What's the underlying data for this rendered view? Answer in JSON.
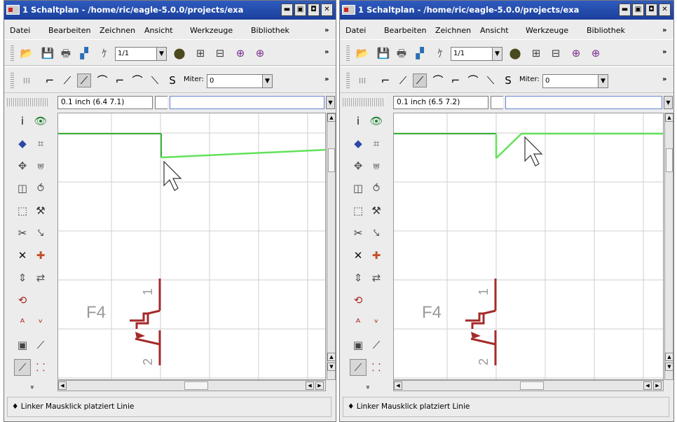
{
  "windows": [
    {
      "title": "1 Schaltplan - /home/ric/eagle-5.0.0/projects/exa",
      "menu": [
        "Datei",
        "Bearbeiten",
        "Zeichnen",
        "Ansicht",
        "Werkzeuge",
        "Bibliothek"
      ],
      "menu_more": "»",
      "zoom_value": "1/1",
      "miter_label": "Miter:",
      "miter_value": "0",
      "coords": "0.1 inch (6.4 7.1)",
      "command_value": "",
      "part_name": "F4",
      "pin1": "1",
      "pin2": "2",
      "status": "Linker Mausklick platziert Linie"
    },
    {
      "title": "1 Schaltplan - /home/ric/eagle-5.0.0/projects/exa",
      "menu": [
        "Datei",
        "Bearbeiten",
        "Zeichnen",
        "Ansicht",
        "Werkzeuge",
        "Bibliothek"
      ],
      "menu_more": "»",
      "zoom_value": "1/1",
      "miter_label": "Miter:",
      "miter_value": "0",
      "coords": "0.1 inch (6.5 7.2)",
      "command_value": "",
      "part_name": "F4",
      "pin1": "1",
      "pin2": "2",
      "status": "Linker Mausklick platziert Linie"
    }
  ],
  "colors": {
    "title_bar": "#2448a8",
    "wire_existing": "#34b033",
    "wire_preview": "#62e25a",
    "symbol": "#a52a2a",
    "part_label": "#9a9a9a",
    "grid": "#cfcfcf"
  },
  "icons": {
    "toolbar": [
      "open-icon",
      "save-icon",
      "print-icon",
      "cam-icon",
      "script-icon",
      "use-library-icon",
      "erc-icon",
      "drc-icon",
      "zoom-fit-icon",
      "zoom-in-icon"
    ],
    "wire_bends": [
      "bend-right-angle-icon",
      "bend-45-icon",
      "bend-straight-icon",
      "bend-45-reverse-icon",
      "bend-right-angle-reverse-icon",
      "bend-arc-icon",
      "bend-arc-reverse-icon",
      "bend-freehand-icon"
    ],
    "sidebar": [
      "info-icon",
      "show-icon",
      "display-layers-icon",
      "mark-icon",
      "move-icon",
      "copy-icon",
      "mirror-icon",
      "rotate-icon",
      "group-icon",
      "change-icon",
      "cut-icon",
      "paste-icon",
      "delete-icon",
      "add-icon",
      "pinswap-icon",
      "gateswap-icon",
      "replace-icon",
      "name-icon",
      "value-icon",
      "smash-icon",
      "split-icon",
      "miter-icon",
      "wire-icon",
      "net-icon",
      "more-icon"
    ]
  }
}
